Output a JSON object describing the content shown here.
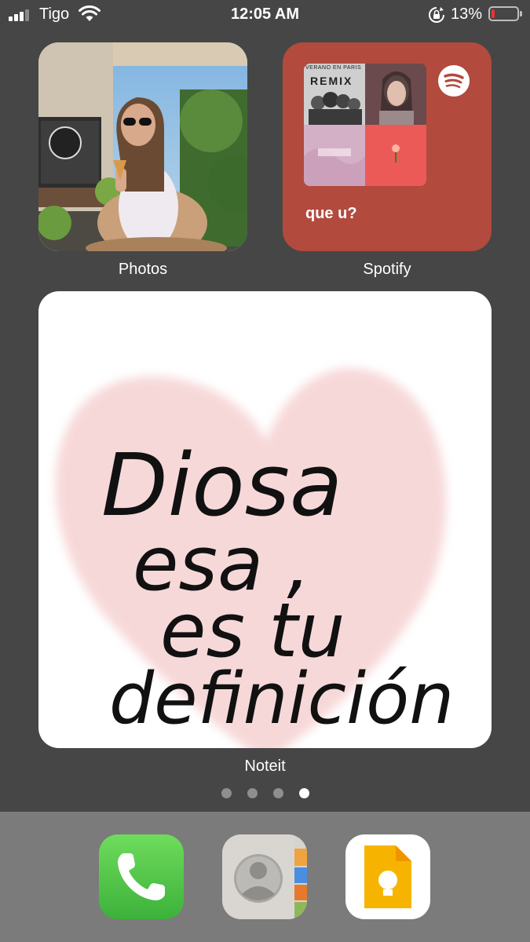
{
  "status_bar": {
    "carrier": "Tigo",
    "time": "12:05 AM",
    "battery_percent": "13%",
    "battery_level": 0.13,
    "signal_bars": 3,
    "icons": [
      "signal-icon",
      "wifi-icon",
      "rotation-lock-icon",
      "battery-icon"
    ]
  },
  "widgets": {
    "photos": {
      "label": "Photos"
    },
    "spotify": {
      "label": "Spotify",
      "playlist_name": "que u?",
      "cover_text": [
        "VERANO EN PARIS",
        "REMIX"
      ],
      "icon": "spotify-logo-icon"
    },
    "noteit": {
      "label": "Noteit",
      "handwritten_lines": [
        "Diosa",
        "esa ,",
        "es tu",
        "definición"
      ]
    }
  },
  "page_indicator": {
    "total": 4,
    "active": 4
  },
  "dock": {
    "apps": [
      "phone-icon",
      "contacts-icon",
      "google-keep-icon"
    ]
  },
  "colors": {
    "background": "#464646",
    "spotify_widget": "#b24a3e",
    "battery_low": "#e33333",
    "dock": "#7b7b7b"
  }
}
